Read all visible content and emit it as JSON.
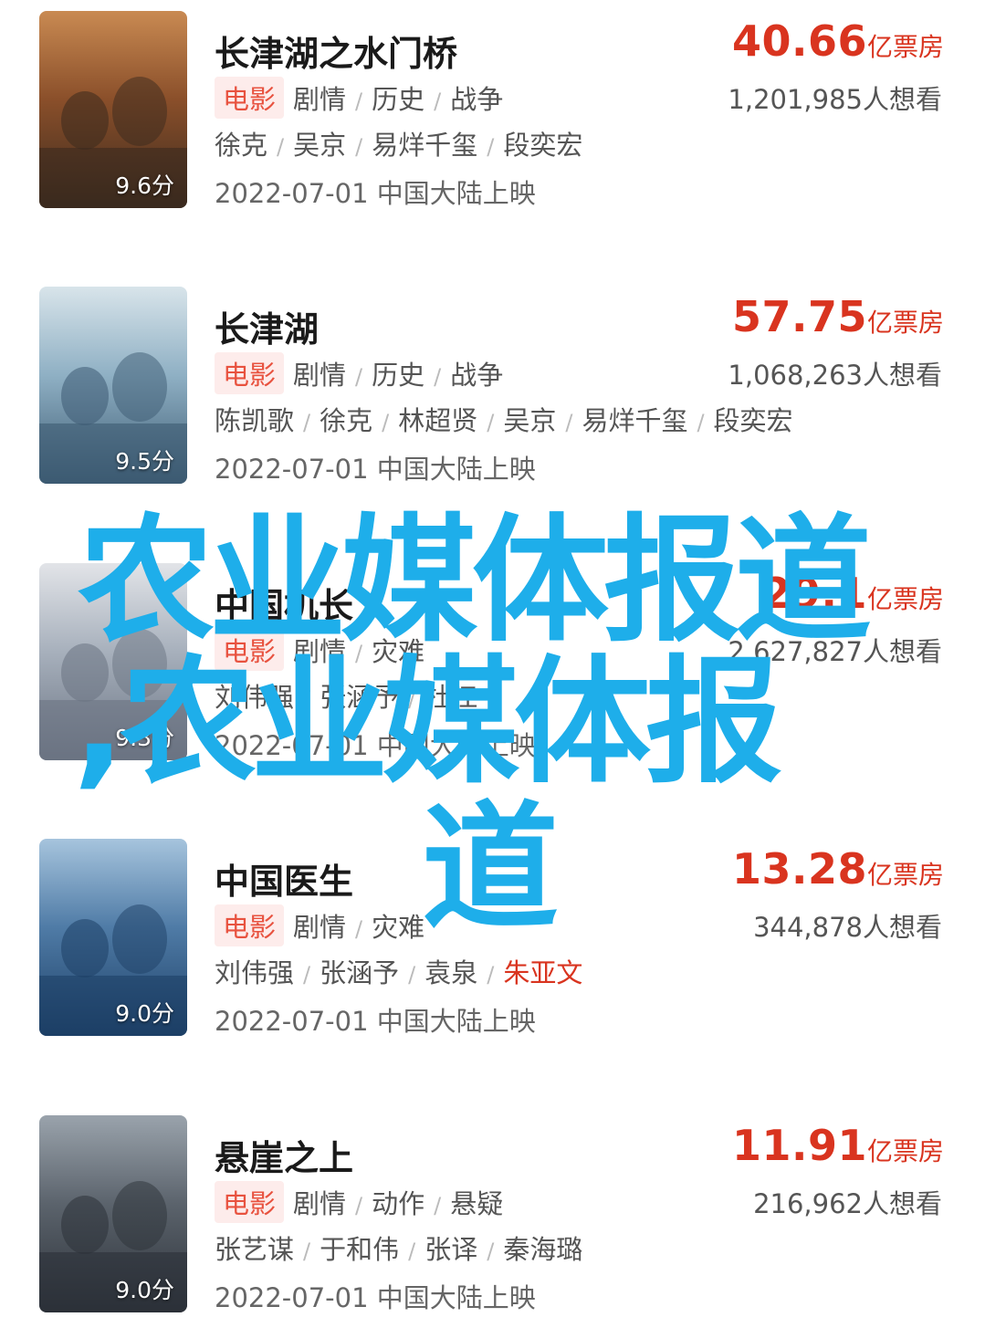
{
  "movies": [
    {
      "title": "长津湖之水门桥",
      "score": "9.6分",
      "type": "电影",
      "genres": [
        "剧情",
        "历史",
        "战争"
      ],
      "cast": [
        "徐克",
        "吴京",
        "易烊千玺",
        "段奕宏"
      ],
      "date": "2022-07-01 中国大陆上映",
      "box_num": "40.66",
      "box_unit": "亿票房",
      "want": "1,201,985人想看",
      "poster_colors": [
        "#3a2a1e",
        "#8a4f2a",
        "#c98a52"
      ]
    },
    {
      "title": "长津湖",
      "score": "9.5分",
      "type": "电影",
      "genres": [
        "剧情",
        "历史",
        "战争"
      ],
      "cast": [
        "陈凯歌",
        "徐克",
        "林超贤",
        "吴京",
        "易烊千玺",
        "段奕宏"
      ],
      "date": "2022-07-01 中国大陆上映",
      "box_num": "57.75",
      "box_unit": "亿票房",
      "want": "1,068,263人想看",
      "poster_colors": [
        "#3c5a72",
        "#8fb0c4",
        "#d8e4ea"
      ]
    },
    {
      "title": "中国机长",
      "score": "9.3分",
      "type": "电影",
      "genres": [
        "剧情",
        "灾难"
      ],
      "cast": [
        "刘伟强",
        "张涵予",
        "杜江"
      ],
      "date": "2022-07-01 中国大陆上映",
      "box_num": "29.1",
      "box_unit": "亿票房",
      "want": "2,627,827人想看",
      "poster_colors": [
        "#6a7382",
        "#a7b0bc",
        "#e2e4e8"
      ]
    },
    {
      "title": "中国医生",
      "score": "9.0分",
      "type": "电影",
      "genres": [
        "剧情",
        "灾难"
      ],
      "cast": [
        "刘伟强",
        "张涵予",
        "袁泉",
        "朱亚文"
      ],
      "cast_highlight_index": 3,
      "date": "2022-07-01 中国大陆上映",
      "box_num": "13.28",
      "box_unit": "亿票房",
      "want": "344,878人想看",
      "poster_colors": [
        "#1d3f66",
        "#4f7ba6",
        "#a6c4dd"
      ]
    },
    {
      "title": "悬崖之上",
      "score": "9.0分",
      "type": "电影",
      "genres": [
        "剧情",
        "动作",
        "悬疑"
      ],
      "cast": [
        "张艺谋",
        "于和伟",
        "张译",
        "秦海璐"
      ],
      "date": "2022-07-01 中国大陆上映",
      "box_num": "11.91",
      "box_unit": "亿票房",
      "want": "216,962人想看",
      "poster_colors": [
        "#2c3138",
        "#5b636c",
        "#9aa3ac"
      ]
    }
  ],
  "overlay": {
    "line1": "农业媒体报道",
    "line2": ",农业媒体报",
    "line3": "道",
    "color": "#1eaeea"
  }
}
